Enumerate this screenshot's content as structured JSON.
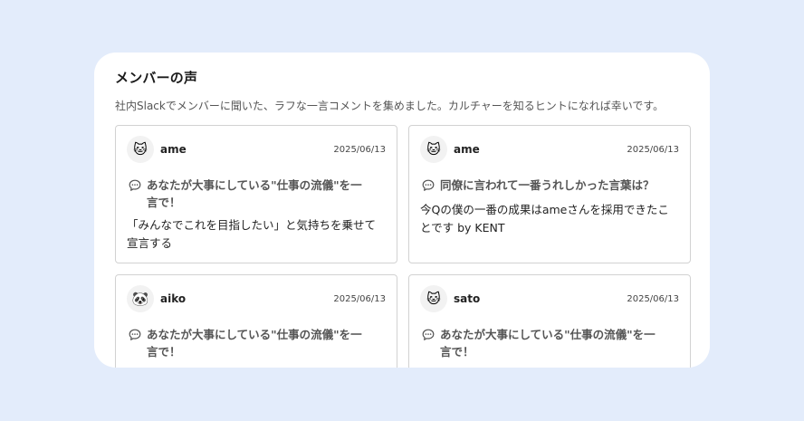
{
  "section": {
    "title": "メンバーの声",
    "description": "社内Slackでメンバーに聞いた、ラフな一言コメントを集めました。カルチャーを知るヒントになれば幸いです。"
  },
  "cards": [
    {
      "avatar": "🐱",
      "avatar_icon": "cat-face-icon",
      "author": "ame",
      "date": "2025/06/13",
      "question": "あなたが大事にしている\"仕事の流儀\"を一言で！",
      "answer": "「みんなでこれを目指したい」と気持ちを乗せて宣言する"
    },
    {
      "avatar": "🐱",
      "avatar_icon": "cat-face-icon",
      "author": "ame",
      "date": "2025/06/13",
      "question": "同僚に言われて一番うれしかった言葉は？",
      "answer": "今Qの僕の一番の成果はameさんを採用できたことです by KENT"
    },
    {
      "avatar": "🐼",
      "avatar_icon": "panda-face-icon",
      "author": "aiko",
      "date": "2025/06/13",
      "question": "あなたが大事にしている\"仕事の流儀\"を一言で！",
      "answer": ""
    },
    {
      "avatar": "🐱",
      "avatar_icon": "cat-face-icon",
      "author": "sato",
      "date": "2025/06/13",
      "question": "あなたが大事にしている\"仕事の流儀\"を一言で！",
      "answer": ""
    }
  ],
  "colors": {
    "background": "#e3ecfb",
    "panel": "#ffffff",
    "card_border": "#d2d2d2"
  }
}
